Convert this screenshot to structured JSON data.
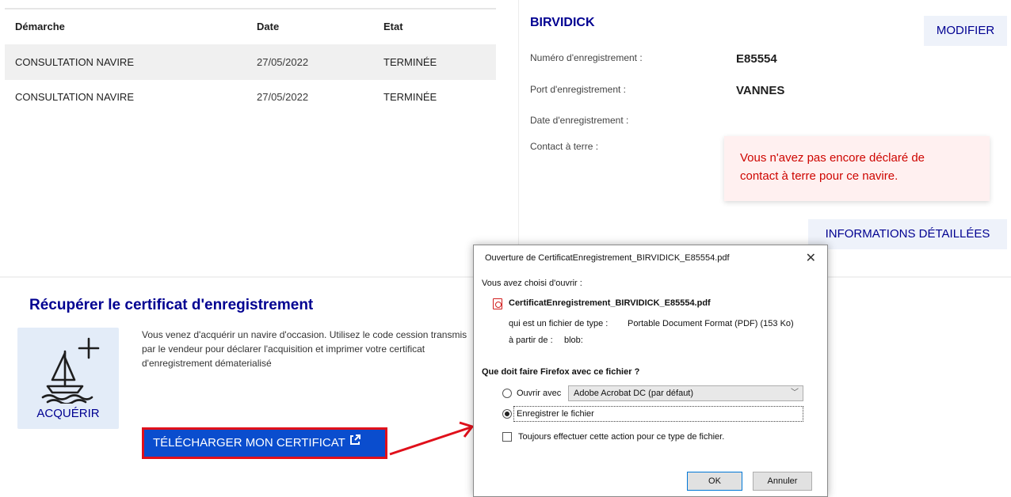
{
  "history": {
    "headers": [
      "Démarche",
      "Date",
      "Etat"
    ],
    "rows": [
      [
        "CONSULTATION NAVIRE",
        "27/05/2022",
        "TERMINÉE"
      ],
      [
        "CONSULTATION NAVIRE",
        "27/05/2022",
        "TERMINÉE"
      ]
    ]
  },
  "ship": {
    "name": "BIRVIDICK",
    "modify_label": "MODIFIER",
    "registration_number_label": "Numéro d'enregistrement :",
    "registration_number": "E85554",
    "port_label": "Port d'enregistrement :",
    "port": "VANNES",
    "date_label": "Date d'enregistrement :",
    "contact_label": "Contact à terre :",
    "alert_line1": "Vous n'avez pas encore déclaré de",
    "alert_line2": "contact à terre pour ce navire.",
    "details_label": "INFORMATIONS DÉTAILLÉES"
  },
  "certificate": {
    "title": "Récupérer le certificat d'enregistrement",
    "tile_label": "ACQUÉRIR",
    "description": "Vous venez d'acquérir un navire d'occasion. Utilisez le code cession transmis par le vendeur pour déclarer l'acquisition et imprimer votre certificat d'enregistrement dématerialisé",
    "download_label": "TÉLÉCHARGER MON CERTIFICAT"
  },
  "dialog": {
    "title": "Ouverture de CertificatEnregistrement_BIRVIDICK_E85554.pdf",
    "chosen_label": "Vous avez choisi d'ouvrir :",
    "filename": "CertificatEnregistrement_BIRVIDICK_E85554.pdf",
    "type_prefix": "qui est un fichier de type :",
    "type_value": "Portable Document Format (PDF) (153 Ko)",
    "from_prefix": "à partir de :",
    "from_value": "blob:",
    "question": "Que doit faire Firefox avec ce fichier ?",
    "open_with_label": "Ouvrir avec",
    "open_with_app": "Adobe Acrobat DC (par défaut)",
    "save_label": "Enregistrer le fichier",
    "always_label": "Toujours effectuer cette action pour ce type de fichier.",
    "ok_label": "OK",
    "cancel_label": "Annuler",
    "selected_option": "save"
  },
  "colors": {
    "accent": "#000091",
    "download_button": "#0a4dce",
    "highlight": "#e0101b",
    "alert_text": "#ce0500"
  },
  "icons": [
    "boat-add-icon",
    "external-link-icon",
    "pdf-file-icon",
    "close-icon",
    "chevron-down-icon",
    "arrow-annotation"
  ]
}
